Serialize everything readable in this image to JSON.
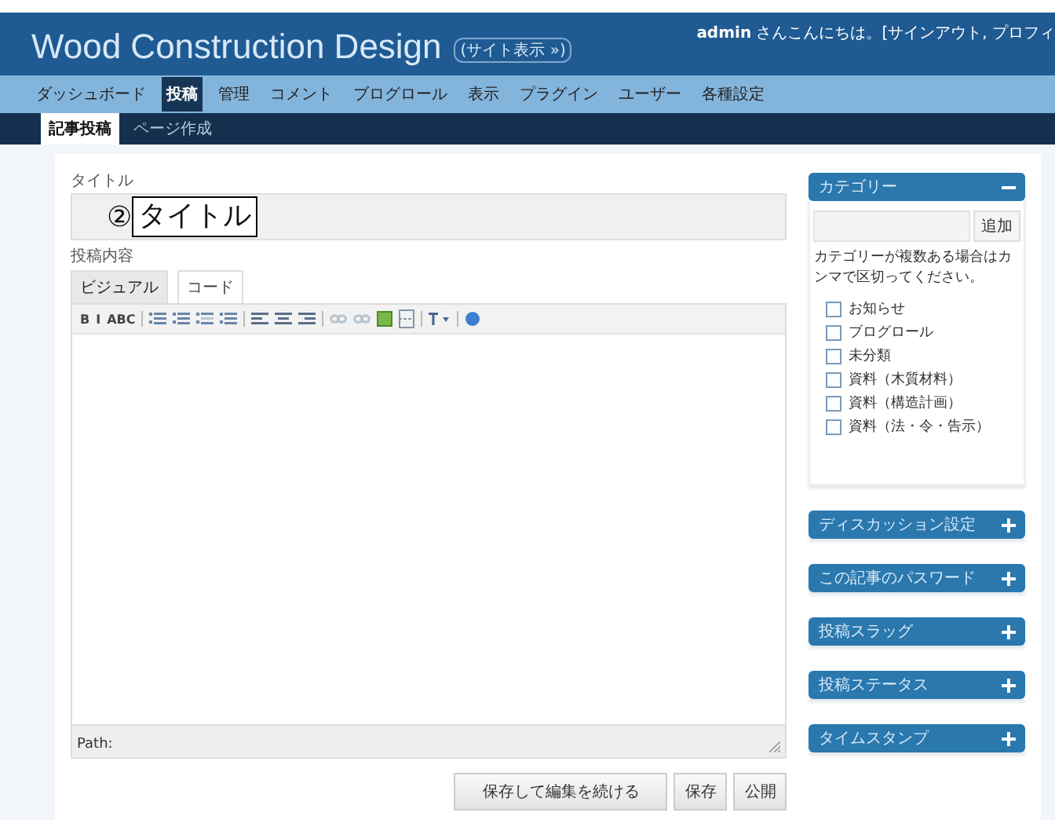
{
  "header": {
    "site_title": "Wood Construction Design",
    "view_site_link": "(サイト表示 »)",
    "greeting": "**admin** さんこんにちは。[サインアウト, プロフィ"
  },
  "nav": [
    {
      "label": "ダッシュボード",
      "selected": false
    },
    {
      "label": "投稿",
      "selected": true
    },
    {
      "label": "管理",
      "selected": false
    },
    {
      "label": "コメント",
      "selected": false
    },
    {
      "label": "ブログロール",
      "selected": false
    },
    {
      "label": "表示",
      "selected": false
    },
    {
      "label": "プラグイン",
      "selected": false
    },
    {
      "label": "ユーザー",
      "selected": false
    },
    {
      "label": "各種設定",
      "selected": false
    }
  ],
  "subnav": [
    {
      "label": "記事投稿",
      "selected": true
    },
    {
      "label": "ページ作成",
      "selected": false
    }
  ],
  "title_field": {
    "label": "タイトル"
  },
  "annotation": {
    "number": "②",
    "label": "タイトル"
  },
  "content": {
    "label": "投稿内容",
    "tabs": [
      {
        "label": "ビジュアル",
        "selected": true
      },
      {
        "label": "コード",
        "selected": false
      }
    ],
    "toolbar": [
      {
        "kind": "text",
        "label": "B"
      },
      {
        "kind": "text",
        "label": "I"
      },
      {
        "kind": "text",
        "label": "ABC"
      },
      {
        "kind": "sep"
      },
      {
        "kind": "bullets"
      },
      {
        "kind": "numbers"
      },
      {
        "kind": "outdent"
      },
      {
        "kind": "indent"
      },
      {
        "kind": "sep"
      },
      {
        "kind": "align-left"
      },
      {
        "kind": "align-center"
      },
      {
        "kind": "align-right"
      },
      {
        "kind": "sep"
      },
      {
        "kind": "link"
      },
      {
        "kind": "unlink"
      },
      {
        "kind": "image"
      },
      {
        "kind": "more"
      },
      {
        "kind": "sep"
      },
      {
        "kind": "spell"
      },
      {
        "kind": "sep"
      },
      {
        "kind": "help"
      }
    ],
    "path_label": "Path:"
  },
  "buttons": [
    "保存して編集を続ける",
    "保存",
    "公開"
  ],
  "sidebar": [
    {
      "title": "カテゴリー",
      "expanded": true,
      "add_button": "追加",
      "hint": "カテゴリーが複数ある場合はカンマで区切ってください。",
      "categories": [
        {
          "label": "お知らせ",
          "checked": false
        },
        {
          "label": "ブログロール",
          "checked": false
        },
        {
          "label": "未分類",
          "checked": false
        },
        {
          "label": "資料（木質材料）",
          "checked": false
        },
        {
          "label": "資料（構造計画）",
          "checked": false
        },
        {
          "label": "資料（法・令・告示）",
          "checked": false
        }
      ]
    },
    {
      "title": "ディスカッション設定",
      "expanded": false
    },
    {
      "title": "この記事のパスワード",
      "expanded": false
    },
    {
      "title": "投稿スラッグ",
      "expanded": false
    },
    {
      "title": "投稿ステータス",
      "expanded": false
    },
    {
      "title": "タイムスタンプ",
      "expanded": false
    }
  ]
}
